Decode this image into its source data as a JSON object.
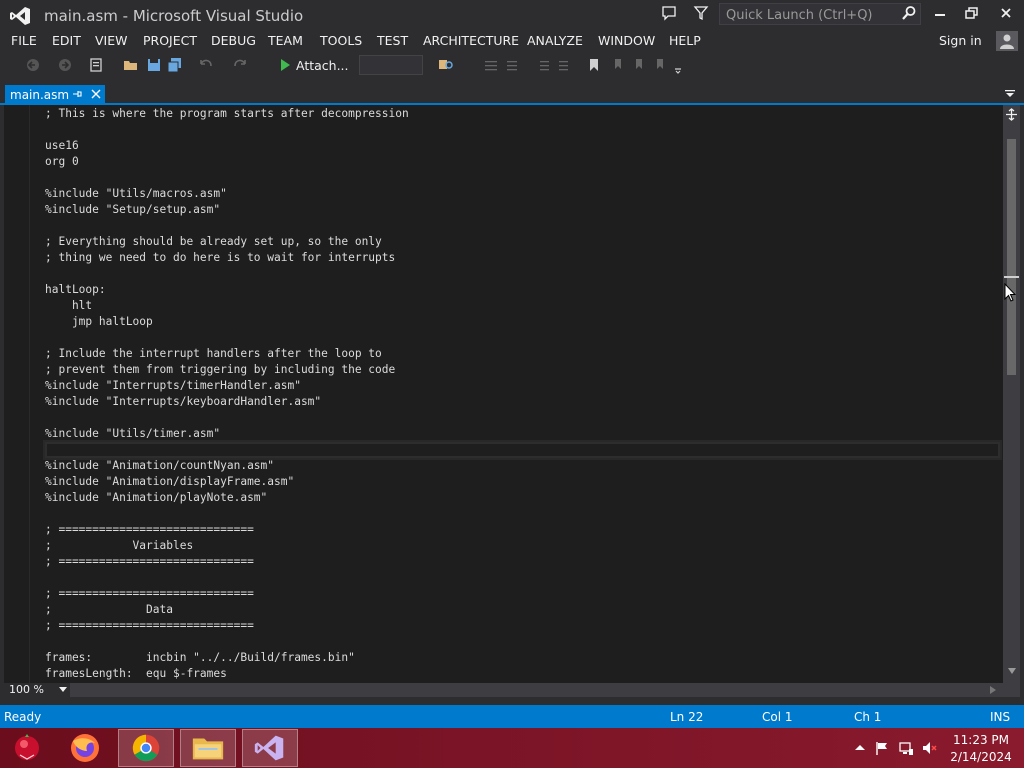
{
  "window": {
    "title": "main.asm - Microsoft Visual Studio"
  },
  "quick_launch": {
    "placeholder": "Quick Launch (Ctrl+Q)"
  },
  "menu": {
    "items": [
      "FILE",
      "EDIT",
      "VIEW",
      "PROJECT",
      "DEBUG",
      "TEAM",
      "TOOLS",
      "TEST",
      "ARCHITECTURE",
      "ANALYZE",
      "WINDOW",
      "HELP"
    ],
    "sign_in": "Sign in"
  },
  "toolbar": {
    "attach_label": "Attach...",
    "config_value": ""
  },
  "tabs": [
    {
      "label": "main.asm",
      "active": true
    }
  ],
  "editor": {
    "current_line_index": 21,
    "lines": [
      "; This is where the program starts after decompression",
      "",
      "use16",
      "org 0",
      "",
      "%include \"Utils/macros.asm\"",
      "%include \"Setup/setup.asm\"",
      "",
      "; Everything should be already set up, so the only",
      "; thing we need to do here is to wait for interrupts",
      "",
      "haltLoop:",
      "    hlt",
      "    jmp haltLoop",
      "",
      "; Include the interrupt handlers after the loop to",
      "; prevent them from triggering by including the code",
      "%include \"Interrupts/timerHandler.asm\"",
      "%include \"Interrupts/keyboardHandler.asm\"",
      "",
      "%include \"Utils/timer.asm\"",
      "",
      "%include \"Animation/countNyan.asm\"",
      "%include \"Animation/displayFrame.asm\"",
      "%include \"Animation/playNote.asm\"",
      "",
      "; =============================",
      ";            Variables",
      "; =============================",
      "",
      "; =============================",
      ";              Data",
      "; =============================",
      "",
      "frames:        incbin \"../../Build/frames.bin\"",
      "framesLength:  equ $-frames"
    ]
  },
  "zoom": {
    "level": "100 %"
  },
  "status": {
    "state": "Ready",
    "line": "Ln 22",
    "col": "Col 1",
    "ch": "Ch 1",
    "mode": "INS"
  },
  "taskbar": {
    "apps": [
      "start-orb",
      "firefox",
      "chrome",
      "file-explorer",
      "visual-studio"
    ],
    "active_app": "visual-studio",
    "clock": {
      "time": "11:23 PM",
      "date": "2/14/2024"
    }
  },
  "colors": {
    "accent": "#007acc",
    "chrome_bg": "#2d2d30",
    "editor_bg": "#1e1e1e",
    "editor_text": "#dcdcdc"
  }
}
